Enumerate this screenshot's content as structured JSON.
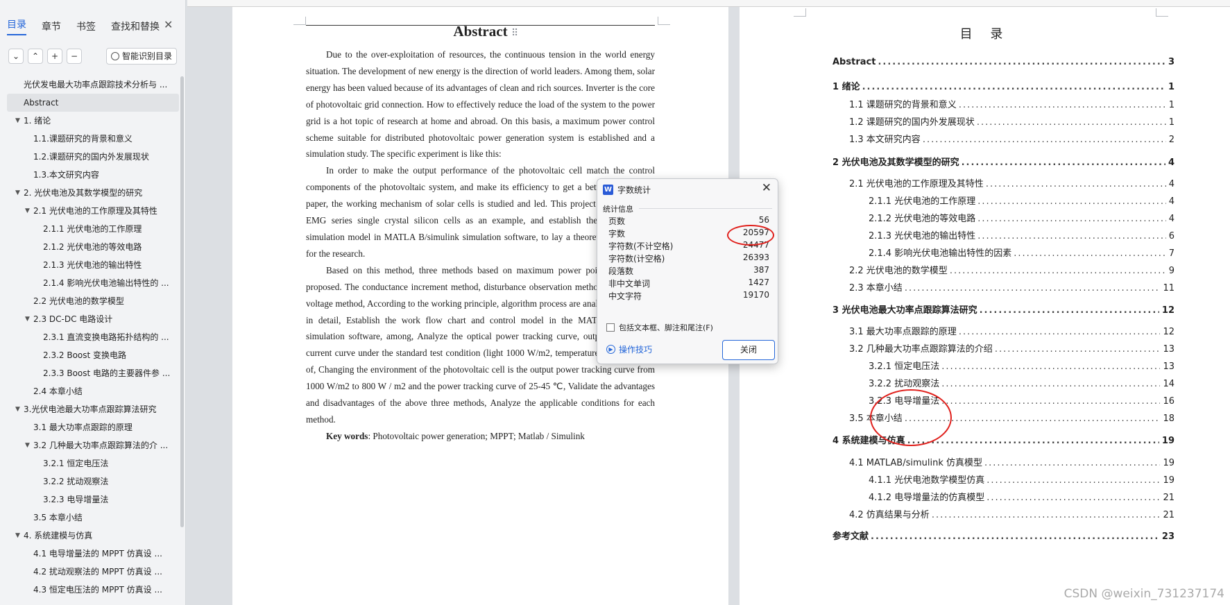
{
  "sidebar": {
    "tabs": [
      "目录",
      "章节",
      "书签",
      "查找和替换"
    ],
    "close_icon": "close-icon",
    "toolbar": [
      "⌄",
      "⌃",
      "+",
      "−"
    ],
    "smart_label": "智能识别目录",
    "items": [
      {
        "label": "光伏发电最大功率点跟踪技术分析与 ..."
      },
      {
        "label": "Abstract"
      },
      {
        "label": "1. 绪论"
      },
      {
        "label": "1.1.课题研究的背景和意义"
      },
      {
        "label": "1.2.课题研究的国内外发展现状"
      },
      {
        "label": "1.3.本文研究内容"
      },
      {
        "label": "2. 光伏电池及其数学模型的研究"
      },
      {
        "label": "2.1 光伏电池的工作原理及其特性"
      },
      {
        "label": "2.1.1 光伏电池的工作原理"
      },
      {
        "label": "2.1.2 光伏电池的等效电路"
      },
      {
        "label": "2.1.3 光伏电池的输出特性"
      },
      {
        "label": "2.1.4 影响光伏电池输出特性的 ..."
      },
      {
        "label": "2.2 光伏电池的数学模型"
      },
      {
        "label": "2.3 DC-DC 电路设计"
      },
      {
        "label": "2.3.1 直流变换电路拓扑结构的 ..."
      },
      {
        "label": "2.3.2 Boost 变换电路"
      },
      {
        "label": "2.3.3 Boost 电路的主要器件参 ..."
      },
      {
        "label": "2.4 本章小结"
      },
      {
        "label": "3.光伏电池最大功率点跟踪算法研究"
      },
      {
        "label": "3.1 最大功率点跟踪的原理"
      },
      {
        "label": "3.2 几种最大功率点跟踪算法的介 ..."
      },
      {
        "label": "3.2.1 恒定电压法"
      },
      {
        "label": "3.2.2 扰动观察法"
      },
      {
        "label": "3.2.3 电导增量法"
      },
      {
        "label": "3.5 本章小结"
      },
      {
        "label": "4. 系统建模与仿真"
      },
      {
        "label": "4.1 电导增量法的 MPPT 仿真设 ..."
      },
      {
        "label": "4.2 扰动观察法的 MPPT 仿真设 ..."
      },
      {
        "label": "4.3 恒定电压法的 MPPT 仿真设 ..."
      }
    ]
  },
  "abstract": {
    "title": "Abstract",
    "p1": "Due to the over-exploitation of resources, the continuous tension in the world energy situation. The development of new energy is the direction of world leaders. Among them, solar energy has been valued because of its advantages of clean and rich sources. Inverter is the core of photovoltaic grid connection. How to effectively reduce the load of the system to the power grid is a hot topic of research at home and abroad. On this basis, a maximum power control scheme suitable for distributed photovoltaic power generation system is established and a simulation study. The specific experiment is like this:",
    "p2": "In order to make the output performance of the photovoltaic cell match the control components of the photovoltaic system, and make its efficiency to get a better play. In this paper, the working mechanism of solar cells is studied and led. This project intends to take EMG series single crystal silicon cells as an example, and establish the corresponding simulation model in MATLA B/simulink simulation software, to lay a theoretical foundation for the research.",
    "p3": "Based on this method, three methods based on maximum power point tracking are proposed. The conductance increment method, disturbance observation method, and constant voltage method, According to the working principle, algorithm process are analyzed separately in detail, Establish the work flow chart and control model in the MATLA B/simulink simulation software, among, Analyze the optical power tracking curve, output voltage and current curve under the standard test condition (light 1000 W/m2, temperature 25℃), on top of, Changing the environment of the photovoltaic cell is the output power tracking curve from 1000 W/m2 to 800 W / m2 and the power tracking curve of 25-45 ℃, Validate the advantages and disadvantages of the above three methods, Analyze the applicable conditions for each method.",
    "kw_label": "Key words",
    "kw_text": ": Photovoltaic power generation; MPPT; Matlab / Simulink"
  },
  "toc": {
    "title": "目 录",
    "lines": [
      {
        "t": "Abstract",
        "p": "3",
        "b": true
      },
      {
        "t": "1 绪论",
        "p": "1",
        "b": true
      },
      {
        "t": "1.1 课题研究的背景和意义",
        "p": "1"
      },
      {
        "t": "1.2 课题研究的国内外发展现状",
        "p": "1"
      },
      {
        "t": "1.3 本文研究内容",
        "p": "2"
      },
      {
        "t": "2 光伏电池及其数学模型的研究",
        "p": "4",
        "b": true
      },
      {
        "t": "2.1 光伏电池的工作原理及其特性",
        "p": "4"
      },
      {
        "t": "2.1.1 光伏电池的工作原理",
        "p": "4"
      },
      {
        "t": "2.1.2 光伏电池的等效电路",
        "p": "4"
      },
      {
        "t": "2.1.3 光伏电池的输出特性",
        "p": "6"
      },
      {
        "t": "2.1.4 影响光伏电池输出特性的因素",
        "p": "7"
      },
      {
        "t": "2.2 光伏电池的数学模型",
        "p": "9"
      },
      {
        "t": "2.3 本章小结",
        "p": "11"
      },
      {
        "t": "3 光伏电池最大功率点跟踪算法研究",
        "p": "12",
        "b": true
      },
      {
        "t": "3.1 最大功率点跟踪的原理",
        "p": "12"
      },
      {
        "t": "3.2 几种最大功率点跟踪算法的介绍",
        "p": "13"
      },
      {
        "t": "3.2.1 恒定电压法",
        "p": "13"
      },
      {
        "t": "3.2.2 扰动观察法",
        "p": "14"
      },
      {
        "t": "3.2.3 电导增量法",
        "p": "16"
      },
      {
        "t": "3.5 本章小结",
        "p": "18"
      },
      {
        "t": "4 系统建模与仿真",
        "p": "19",
        "b": true
      },
      {
        "t": "4.1 MATLAB/simulink 仿真模型",
        "p": "19"
      },
      {
        "t": "4.1.1 光伏电池数学模型仿真",
        "p": "19"
      },
      {
        "t": "4.1.2 电导增量法的仿真模型",
        "p": "21"
      },
      {
        "t": "4.2 仿真结果与分析",
        "p": "21"
      },
      {
        "t": "参考文献",
        "p": "23",
        "b": true
      }
    ]
  },
  "dialog": {
    "title": "字数统计",
    "section": "统计信息",
    "stats": [
      {
        "label": "页数",
        "value": "56"
      },
      {
        "label": "字数",
        "value": "20597"
      },
      {
        "label": "字符数(不计空格)",
        "value": "24477"
      },
      {
        "label": "字符数(计空格)",
        "value": "26393"
      },
      {
        "label": "段落数",
        "value": "387"
      },
      {
        "label": "非中文单词",
        "value": "1427"
      },
      {
        "label": "中文字符",
        "value": "19170"
      }
    ],
    "checkbox_label": "包括文本框、脚注和尾注(F)",
    "tips_label": "操作技巧",
    "close_label": "关闭"
  },
  "watermark": "CSDN @weixin_731237174",
  "colors": {
    "accent": "#2466d9",
    "highlight_ring": "#e0201c"
  }
}
